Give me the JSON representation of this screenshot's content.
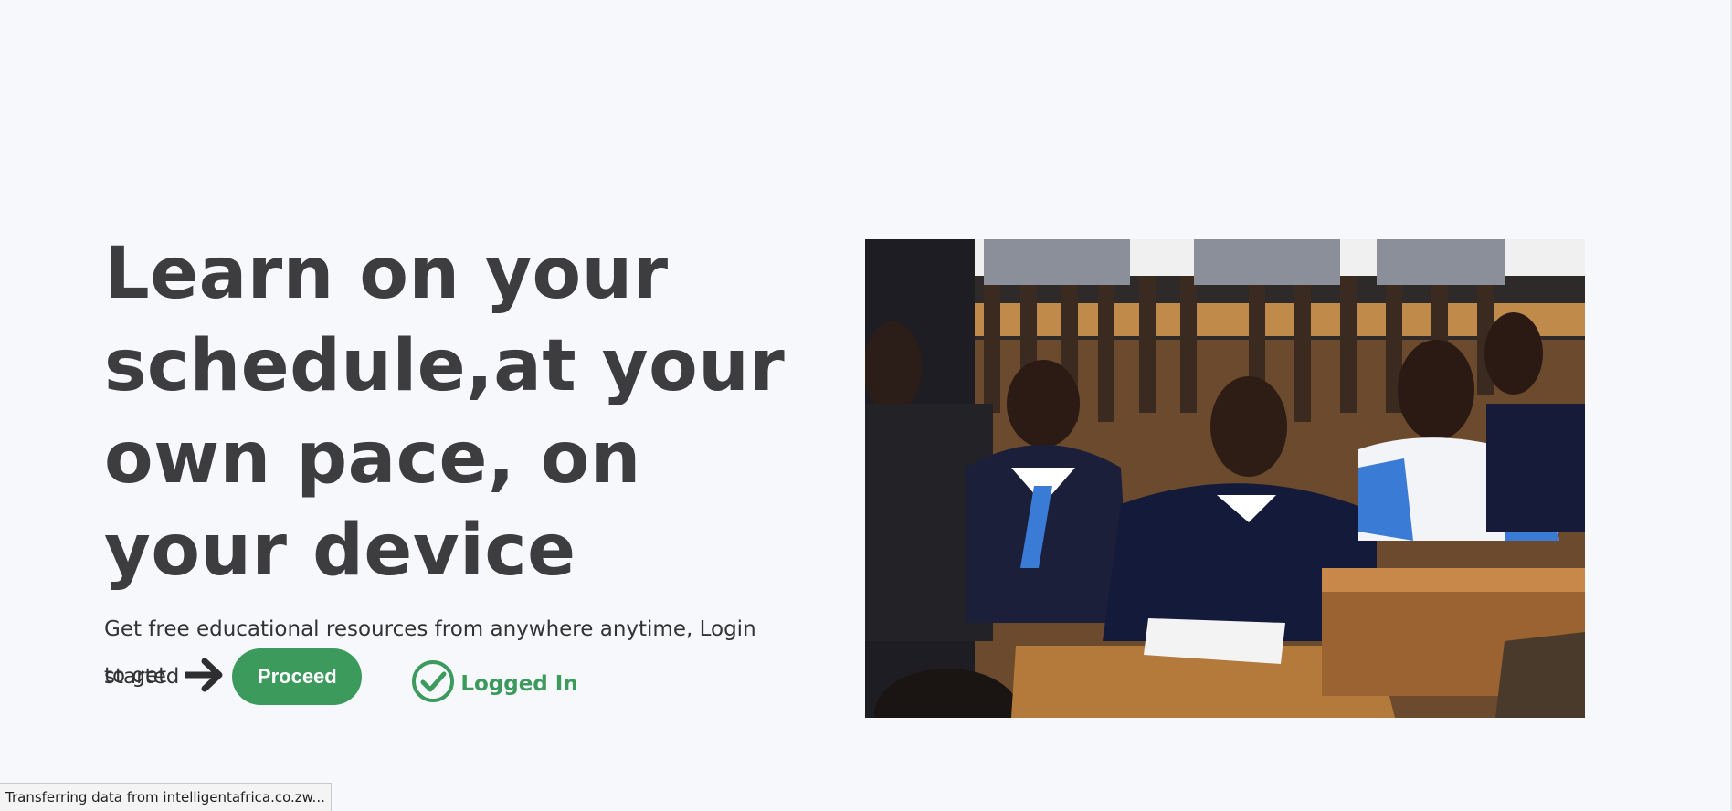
{
  "hero": {
    "heading": "Learn on your schedule,at your own pace, on your device",
    "description": "Get free educational resources from anywhere anytime, Login to get",
    "started_text": "started",
    "proceed_label": "Proceed",
    "status_label": "Logged In",
    "photo_icon": "classroom-photo"
  },
  "status_bar": {
    "text": "Transferring data from intelligentafrica.co.zw..."
  },
  "colors": {
    "accent_green": "#3b9a5c",
    "heading": "#3d3d40",
    "background": "#f7f8fc"
  }
}
